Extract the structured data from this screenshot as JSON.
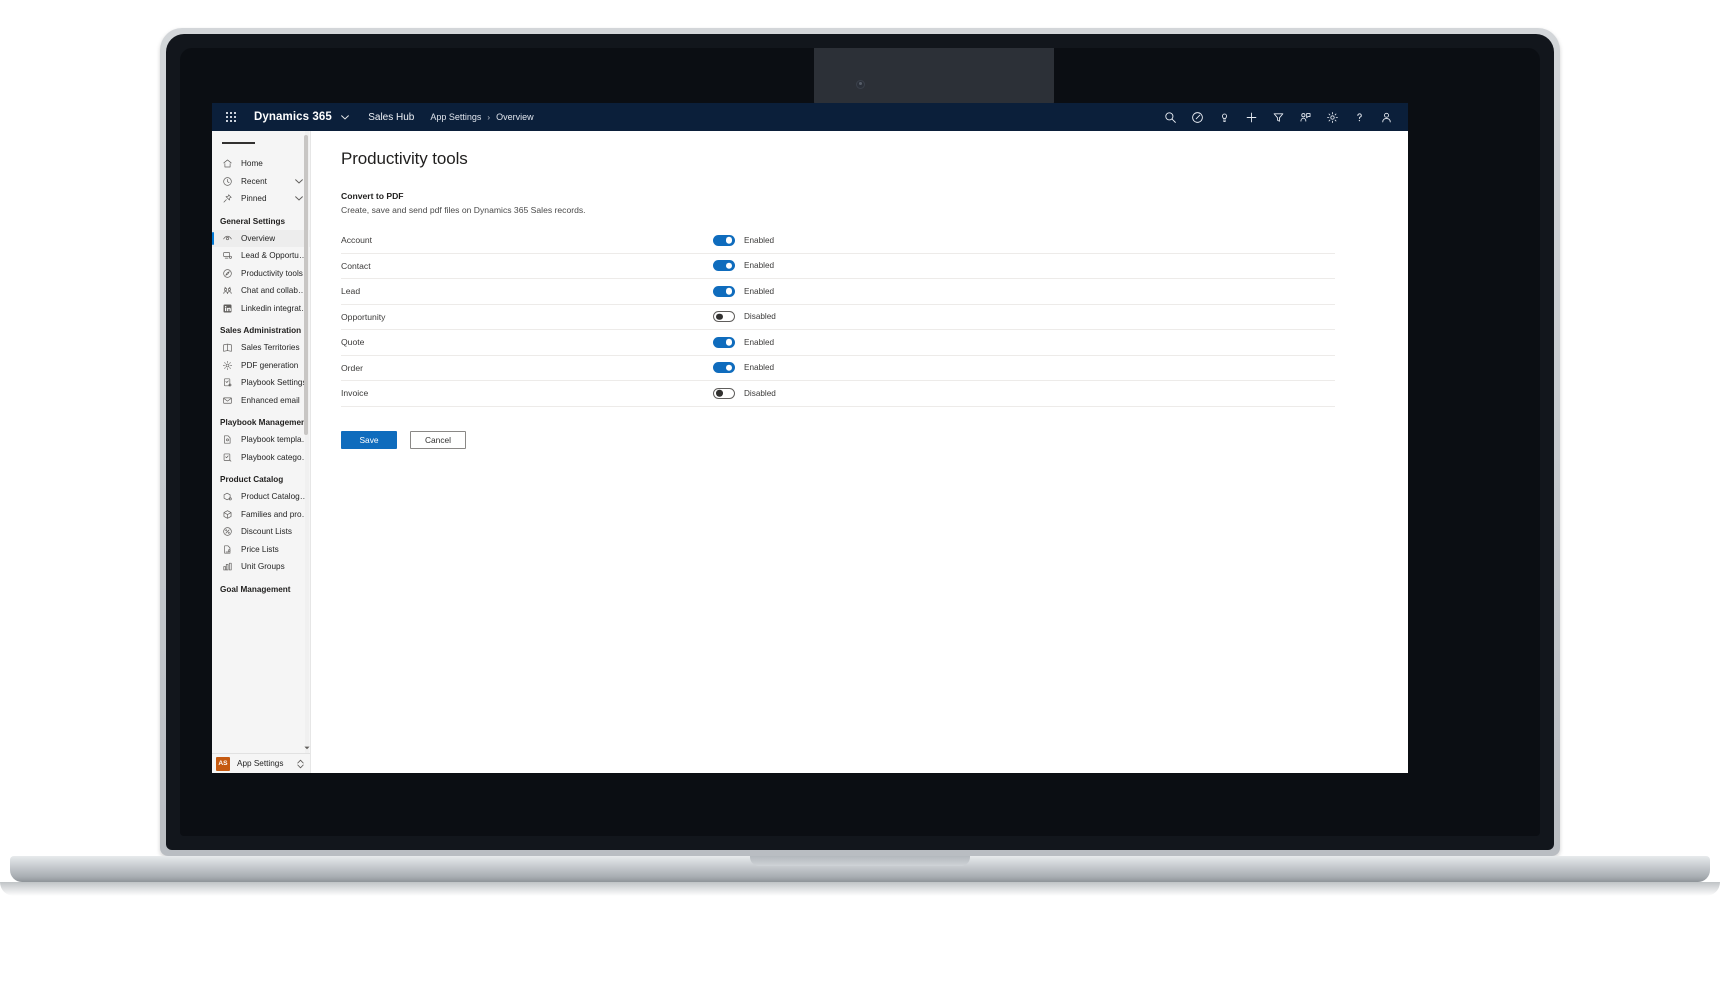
{
  "appbar": {
    "waffle_label": "App launcher",
    "brand": "Dynamics 365",
    "app_name": "Sales Hub",
    "breadcrumb": [
      "App Settings",
      "Overview"
    ],
    "breadcrumb_separator": "›",
    "icons": [
      {
        "name": "search-icon",
        "label": "Search"
      },
      {
        "name": "assistant-icon",
        "label": "Assistant"
      },
      {
        "name": "lightbulb-icon",
        "label": "Insights"
      },
      {
        "name": "plus-icon",
        "label": "Quick create"
      },
      {
        "name": "filter-icon",
        "label": "Filter"
      },
      {
        "name": "relationship-assistant-icon",
        "label": "Relationship assistant"
      },
      {
        "name": "gear-icon",
        "label": "Settings"
      },
      {
        "name": "help-icon",
        "label": "Help"
      },
      {
        "name": "person-icon",
        "label": "Account manager"
      }
    ]
  },
  "sidebar": {
    "hamburger_label": "Collapse navigation",
    "quick": [
      {
        "label": "Home",
        "icon": "home-icon",
        "chevron": false
      },
      {
        "label": "Recent",
        "icon": "clock-icon",
        "chevron": true
      },
      {
        "label": "Pinned",
        "icon": "pin-icon",
        "chevron": true
      }
    ],
    "groups": [
      {
        "title": "General Settings",
        "items": [
          {
            "label": "Overview",
            "icon": "overview-icon",
            "active": true
          },
          {
            "label": "Lead & Opportuni...",
            "icon": "lead-opportunity-icon",
            "active": false
          },
          {
            "label": "Productivity tools",
            "icon": "productivity-icon",
            "active": false
          },
          {
            "label": "Chat and collabor...",
            "icon": "chat-collaboration-icon",
            "active": false
          },
          {
            "label": "Linkedin integration",
            "icon": "linkedin-icon",
            "active": false
          }
        ]
      },
      {
        "title": "Sales Administration",
        "items": [
          {
            "label": "Sales Territories",
            "icon": "map-icon",
            "active": false
          },
          {
            "label": "PDF generation",
            "icon": "gear-icon",
            "active": false
          },
          {
            "label": "Playbook Settings",
            "icon": "playbook-settings-icon",
            "active": false
          },
          {
            "label": "Enhanced email",
            "icon": "mail-icon",
            "active": false
          }
        ]
      },
      {
        "title": "Playbook Management",
        "items": [
          {
            "label": "Playbook templates",
            "icon": "template-icon",
            "active": false
          },
          {
            "label": "Playbook categories",
            "icon": "category-icon",
            "active": false
          }
        ]
      },
      {
        "title": "Product Catalog",
        "items": [
          {
            "label": "Product Catalog S...",
            "icon": "catalog-settings-icon",
            "active": false
          },
          {
            "label": "Families and prod...",
            "icon": "cube-icon",
            "active": false
          },
          {
            "label": "Discount Lists",
            "icon": "discount-icon",
            "active": false
          },
          {
            "label": "Price Lists",
            "icon": "price-list-icon",
            "active": false
          },
          {
            "label": "Unit Groups",
            "icon": "unit-groups-icon",
            "active": false
          }
        ]
      },
      {
        "title": "Goal Management",
        "items": []
      }
    ],
    "footer": {
      "avatar_initials": "AS",
      "label": "App Settings",
      "chevron_icon": "chevron-updown-icon"
    }
  },
  "main": {
    "page_title": "Productivity tools",
    "section": {
      "title": "Convert to PDF",
      "description": "Create, save and send pdf files on Dynamics 365 Sales records."
    },
    "rows": [
      {
        "label": "Account",
        "enabled": true,
        "state_text": "Enabled"
      },
      {
        "label": "Contact",
        "enabled": true,
        "state_text": "Enabled"
      },
      {
        "label": "Lead",
        "enabled": true,
        "state_text": "Enabled"
      },
      {
        "label": "Opportunity",
        "enabled": false,
        "state_text": "Disabled"
      },
      {
        "label": "Quote",
        "enabled": true,
        "state_text": "Enabled"
      },
      {
        "label": "Order",
        "enabled": true,
        "state_text": "Enabled"
      },
      {
        "label": "Invoice",
        "enabled": false,
        "state_text": "Disabled"
      }
    ],
    "buttons": {
      "save": "Save",
      "cancel": "Cancel"
    }
  },
  "colors": {
    "appbar_bg": "#0b1f3a",
    "accent": "#0f6cbd",
    "toggle_on": "#0f6cbd",
    "active_indicator": "#0078d4",
    "avatar_bg": "#c55a11",
    "sidebar_bg": "#f5f5f5"
  }
}
